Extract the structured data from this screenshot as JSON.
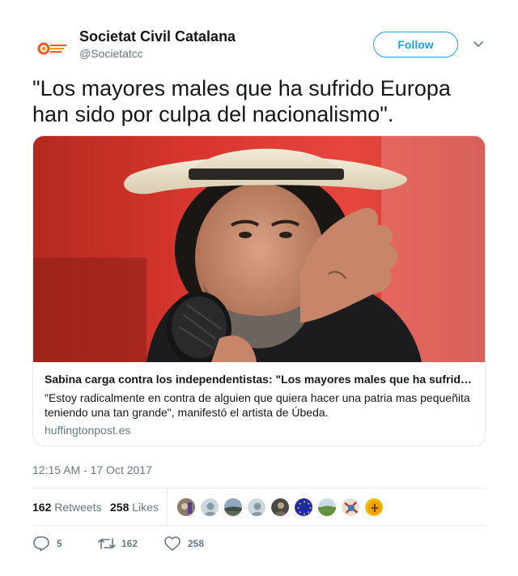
{
  "account": {
    "display_name": "Societat Civil Catalana",
    "handle": "@Societatcc",
    "follow_label": "Follow"
  },
  "tweet": {
    "text": "\"Los mayores males que ha sufrido Europa han sido por culpa del nacionalismo\".",
    "timestamp": "12:15 AM - 17 Oct 2017"
  },
  "card": {
    "title": "Sabina carga contra los independentistas: \"Los mayores males que ha sufrido Europa han sido por culpa del nacionalismo\"",
    "description": "\"Estoy radicalmente en contra de alguien que quiera hacer una patria mas pequeñita teniendo una tan grande\", manifestó el artista de Úbeda.",
    "domain": "huffingtonpost.es"
  },
  "stats": {
    "retweets_count": "162",
    "retweets_label": "Retweets",
    "likes_count": "258",
    "likes_label": "Likes"
  },
  "actions": {
    "reply_count": "5",
    "retweet_count": "162",
    "like_count": "258"
  },
  "icons": [
    "caret-down-icon",
    "reply-icon",
    "retweet-icon",
    "heart-icon"
  ],
  "colors": {
    "accent": "#1da1f2",
    "muted_text": "#657786",
    "border": "#e1e8ed",
    "logo_orange": "#f15a24"
  }
}
